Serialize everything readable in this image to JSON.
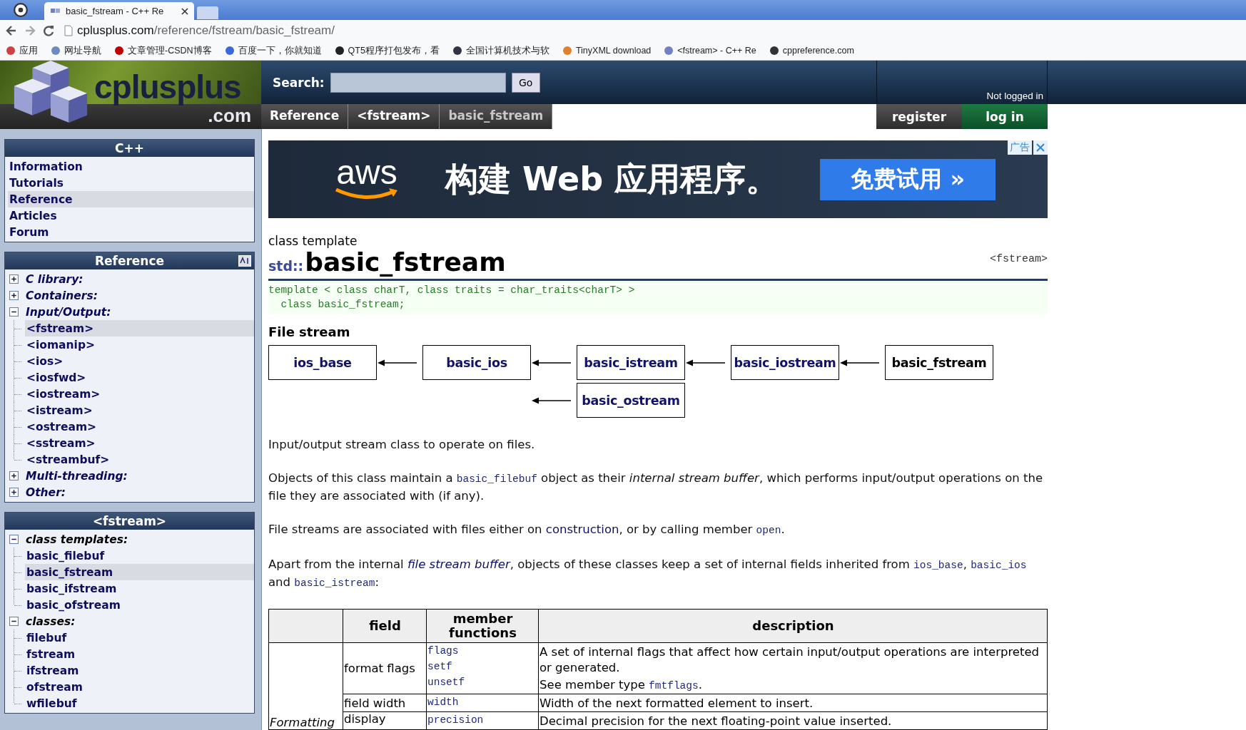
{
  "browser": {
    "tabs": [
      {
        "title": "basic_fstream - C++ Re",
        "selected": true
      }
    ],
    "address": {
      "host": "cplusplus.com",
      "path": "/reference/fstream/basic_fstream/"
    },
    "bookmarks": [
      {
        "label": "应用"
      },
      {
        "label": "网址导航"
      },
      {
        "label": "文章管理-CSDN博客"
      },
      {
        "label": "百度一下，你就知道"
      },
      {
        "label": "QT5程序打包发布，看"
      },
      {
        "label": "全国计算机技术与软"
      },
      {
        "label": "TinyXML download"
      },
      {
        "label": "<fstream> - C++ Re"
      },
      {
        "label": "cppreference.com"
      }
    ]
  },
  "header": {
    "logo_main": "cplusplus",
    "logo_sub": ".com",
    "search_label": "Search:",
    "search_button": "Go",
    "login_status": "Not logged in",
    "breadcrumbs": [
      {
        "label": "Reference",
        "selected": false
      },
      {
        "label": "<fstream>",
        "selected": false
      },
      {
        "label": "basic_fstream",
        "selected": true
      }
    ],
    "register": "register",
    "login": "log in"
  },
  "sidebar": [
    {
      "title": "C++",
      "sort_icon": false,
      "items": [
        {
          "label": "Information",
          "selected": false
        },
        {
          "label": "Tutorials",
          "selected": false
        },
        {
          "label": "Reference",
          "selected": true
        },
        {
          "label": "Articles",
          "selected": false
        },
        {
          "label": "Forum",
          "selected": false
        }
      ]
    },
    {
      "title": "Reference",
      "sort_icon": true,
      "items": [
        {
          "label": "C library:",
          "expanded": false,
          "selected": false
        },
        {
          "label": "Containers:",
          "expanded": false,
          "selected": false
        },
        {
          "label": "Input/Output:",
          "expanded": true,
          "selected": false,
          "children": [
            {
              "label": "<fstream>",
              "selected": true
            },
            {
              "label": "<iomanip>",
              "selected": false
            },
            {
              "label": "<ios>",
              "selected": false
            },
            {
              "label": "<iosfwd>",
              "selected": false
            },
            {
              "label": "<iostream>",
              "selected": false
            },
            {
              "label": "<istream>",
              "selected": false
            },
            {
              "label": "<ostream>",
              "selected": false
            },
            {
              "label": "<sstream>",
              "selected": false
            },
            {
              "label": "<streambuf>",
              "selected": false
            }
          ]
        },
        {
          "label": "Multi-threading:",
          "expanded": false,
          "selected": false
        },
        {
          "label": "Other:",
          "expanded": false,
          "selected": false
        }
      ]
    },
    {
      "title": "<fstream>",
      "sort_icon": false,
      "items": [
        {
          "label": "class templates:",
          "expanded": true,
          "selected": false,
          "children": [
            {
              "label": "basic_filebuf",
              "selected": false
            },
            {
              "label": "basic_fstream",
              "selected": true
            },
            {
              "label": "basic_ifstream",
              "selected": false
            },
            {
              "label": "basic_ofstream",
              "selected": false
            }
          ]
        },
        {
          "label": "classes:",
          "expanded": true,
          "selected": false,
          "children": [
            {
              "label": "filebuf",
              "selected": false
            },
            {
              "label": "fstream",
              "selected": false
            },
            {
              "label": "ifstream",
              "selected": false
            },
            {
              "label": "ofstream",
              "selected": false
            },
            {
              "label": "wfilebuf",
              "selected": false
            }
          ]
        }
      ]
    }
  ],
  "ad": {
    "logo": "aws",
    "headline": "构建 Web 应用程序。",
    "button": "免费试用 »",
    "badge": "广告"
  },
  "article": {
    "kind_label": "class template",
    "namespace": "std::",
    "title": "basic_fstream",
    "header_file": "<fstream>",
    "code": [
      "template < class charT, class traits = char_traits<charT> >",
      "  class basic_fstream;"
    ],
    "section": "File stream",
    "diagram": {
      "top_row": [
        {
          "label": "ios_base",
          "current": false
        },
        {
          "label": "basic_ios",
          "current": false
        },
        {
          "label": "basic_istream",
          "current": false
        },
        {
          "label": "basic_iostream",
          "current": false
        },
        {
          "label": "basic_fstream",
          "current": true
        }
      ],
      "bottom_row": [
        {
          "label": "basic_ostream",
          "current": false
        }
      ]
    },
    "paragraphs": [
      [
        {
          "kind": "text",
          "text": "Input/output stream class to operate on files."
        }
      ],
      [
        {
          "kind": "text",
          "text": "Objects of this class maintain a "
        },
        {
          "kind": "code",
          "text": "basic_filebuf"
        },
        {
          "kind": "text",
          "text": " object as their "
        },
        {
          "kind": "em",
          "text": "internal stream buffer"
        },
        {
          "kind": "text",
          "text": ", which performs input/output operations on the file they are associated with (if any)."
        }
      ],
      [
        {
          "kind": "text",
          "text": "File streams are associated with files either on "
        },
        {
          "kind": "link",
          "text": "construction"
        },
        {
          "kind": "text",
          "text": ", or by calling member "
        },
        {
          "kind": "code",
          "text": "open"
        },
        {
          "kind": "text",
          "text": "."
        }
      ],
      [
        {
          "kind": "text",
          "text": "Apart from the internal "
        },
        {
          "kind": "em_link",
          "text": "file stream buffer"
        },
        {
          "kind": "text",
          "text": ", objects of these classes keep a set of internal fields inherited from "
        },
        {
          "kind": "code",
          "text": "ios_base"
        },
        {
          "kind": "text",
          "text": ", "
        },
        {
          "kind": "code",
          "text": "basic_ios"
        },
        {
          "kind": "text",
          "text": " and "
        },
        {
          "kind": "code",
          "text": "basic_istream"
        },
        {
          "kind": "text",
          "text": ":"
        }
      ]
    ],
    "table": {
      "columns": [
        "field",
        "member functions",
        "description"
      ],
      "group": "Formatting",
      "rows": [
        {
          "field": "format flags",
          "functions": [
            "flags",
            "setf",
            "unsetf"
          ],
          "description": [
            [
              {
                "kind": "text",
                "text": "A set of internal flags that affect how certain input/output operations are interpreted or generated."
              }
            ],
            [
              {
                "kind": "text",
                "text": "See member type "
              },
              {
                "kind": "code",
                "text": "fmtflags"
              },
              {
                "kind": "text",
                "text": "."
              }
            ]
          ]
        },
        {
          "field": "field width",
          "functions": [
            "width"
          ],
          "description": [
            [
              {
                "kind": "text",
                "text": "Width of the next formatted element to insert."
              }
            ]
          ]
        },
        {
          "field": "display",
          "functions": [
            "precision"
          ],
          "description": [
            [
              {
                "kind": "text",
                "text": "Decimal precision for the next floating-point value inserted."
              }
            ]
          ]
        }
      ]
    }
  }
}
